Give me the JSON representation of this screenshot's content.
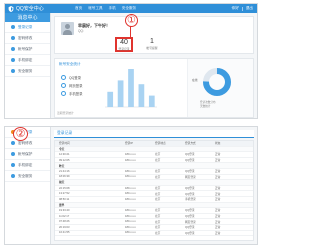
{
  "app": {
    "logo_text": "QQ安全中心",
    "nav": [
      "首页",
      "帐号工具",
      "手机",
      "安全服务"
    ],
    "top_right": [
      "你好",
      "退出"
    ],
    "brand_color": "#2f8fd8",
    "annotation_color": "#e0342e"
  },
  "panel1": {
    "sidebar_title": "消息中心",
    "sidebar_items": [
      "登录记录",
      "密码修改",
      "帐号保护",
      "手机绑定",
      "安全服务"
    ],
    "greeting": "早晨好，下午好！",
    "greeting_sub": "QQ:",
    "stat_primary": {
      "value": "40",
      "label": "登录记录"
    },
    "stat_secondary": {
      "value": "1",
      "label": "帐号提醒"
    },
    "annotation_number": "①",
    "stats_section_title": "帐号安全统计",
    "legend": [
      "QQ登录",
      "网页登录",
      "手机登录"
    ],
    "chart_note": "近期登录统计",
    "pie_label": "在线",
    "pie_note": [
      "登录次数分布",
      "天数统计"
    ]
  },
  "panel2": {
    "annotation_number": "②",
    "header_title": "登录记录",
    "sidebar_items": [
      "登录记录",
      "密码修改",
      "帐号保护",
      "手机绑定",
      "安全服务"
    ],
    "table_headers": [
      "登录时间",
      "登录IP",
      "登录地点",
      "登录方式",
      "状态"
    ],
    "rows": [
      {
        "type": "group",
        "text": "今天"
      },
      {
        "type": "row",
        "cells": [
          "12:30:21",
          "180.x.x.x",
          "北京",
          "QQ登录",
          "正常"
        ]
      },
      {
        "type": "row",
        "cells": [
          "09:12:05",
          "180.x.x.x",
          "北京",
          "QQ登录",
          "正常"
        ]
      },
      {
        "type": "group",
        "text": "昨天"
      },
      {
        "type": "row",
        "cells": [
          "21:44:16",
          "180.x.x.x",
          "北京",
          "QQ登录",
          "正常"
        ]
      },
      {
        "type": "row",
        "cells": [
          "18:06:39",
          "180.x.x.x",
          "北京",
          "网页登录",
          "正常"
        ]
      },
      {
        "type": "group",
        "text": "前天"
      },
      {
        "type": "row",
        "cells": [
          "22:15:08",
          "180.x.x.x",
          "北京",
          "QQ登录",
          "正常"
        ]
      },
      {
        "type": "row",
        "cells": [
          "13:27:52",
          "180.x.x.x",
          "北京",
          "QQ登录",
          "正常"
        ]
      },
      {
        "type": "row",
        "cells": [
          "08:50:11",
          "180.x.x.x",
          "北京",
          "手机登录",
          "正常"
        ]
      },
      {
        "type": "group",
        "text": "更早"
      },
      {
        "type": "row",
        "cells": [
          "19:33:40",
          "180.x.x.x",
          "北京",
          "QQ登录",
          "正常"
        ]
      },
      {
        "type": "row",
        "cells": [
          "11:02:17",
          "180.x.x.x",
          "北京",
          "QQ登录",
          "正常"
        ]
      },
      {
        "type": "row",
        "cells": [
          "07:48:26",
          "180.x.x.x",
          "北京",
          "网页登录",
          "正常"
        ]
      },
      {
        "type": "row",
        "cells": [
          "20:19:03",
          "180.x.x.x",
          "北京",
          "QQ登录",
          "正常"
        ]
      },
      {
        "type": "row",
        "cells": [
          "16:41:55",
          "180.x.x.x",
          "北京",
          "QQ登录",
          "正常"
        ]
      }
    ]
  },
  "chart_data": {
    "type": "bar",
    "categories": [
      "1",
      "2",
      "3",
      "4",
      "5"
    ],
    "values": [
      4,
      7,
      10,
      6,
      3
    ],
    "title": "",
    "xlabel": "",
    "ylabel": ""
  }
}
